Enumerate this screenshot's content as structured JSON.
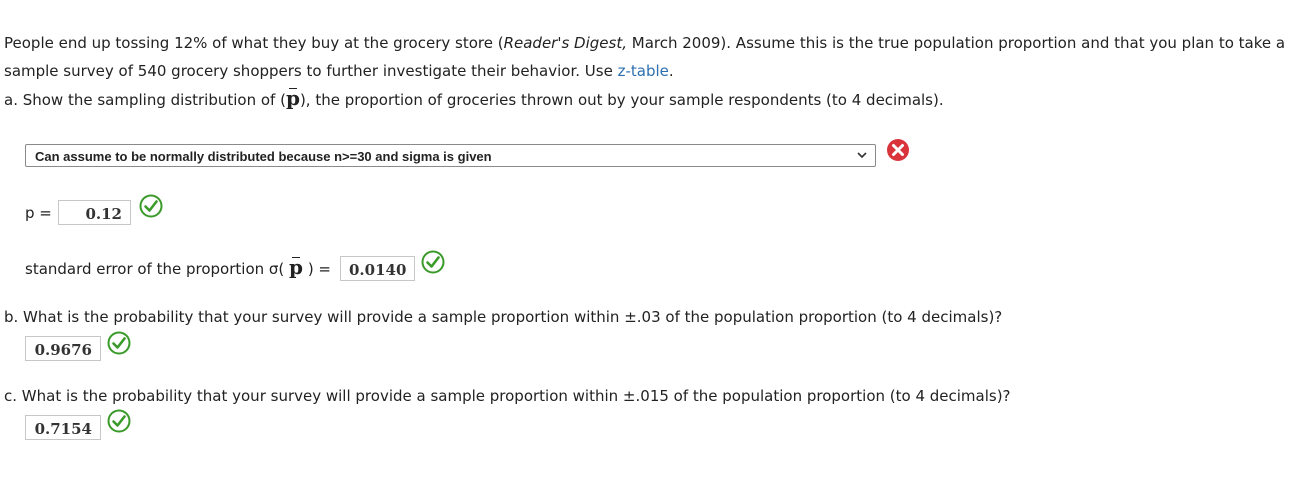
{
  "intro": {
    "line1_text_a": "People end up tossing 12% of what they buy at the grocery store (",
    "line1_source": "Reader's Digest,",
    "line1_text_b": " March 2009). Assume this is the true population proportion and that you plan to take a",
    "line2_text_a": "sample survey of 540 grocery shoppers to further investigate their behavior. Use ",
    "line2_link": "z-table",
    "line2_text_b": "."
  },
  "part_a": {
    "question_start": "a. Show the sampling distribution of (",
    "question_symbol": "p",
    "question_end": "), the proportion of groceries thrown out by your sample respondents (to 4 decimals).",
    "dropdown_selected": "Can assume to be normally distributed because n>=30 and sigma is given",
    "dropdown_status": "incorrect",
    "p_label": "p =",
    "p_value": "0.12",
    "p_status": "correct",
    "se_label_start": "standard error of the proportion σ(",
    "se_label_symbol": "p",
    "se_label_end": ") =",
    "se_value": "0.0140",
    "se_status": "correct"
  },
  "part_b": {
    "question": "b. What is the probability that your survey will provide a sample proportion within ±.03 of the population proportion (to 4 decimals)?",
    "answer": "0.9676",
    "status": "correct"
  },
  "part_c": {
    "question": "c. What is the probability that your survey will provide a sample proportion within ±.015 of the population proportion (to 4 decimals)?",
    "answer": "0.7154",
    "status": "correct"
  },
  "colors": {
    "correct": "#3a9a2a",
    "incorrect": "#d9343c",
    "link": "#2c6fb0"
  }
}
